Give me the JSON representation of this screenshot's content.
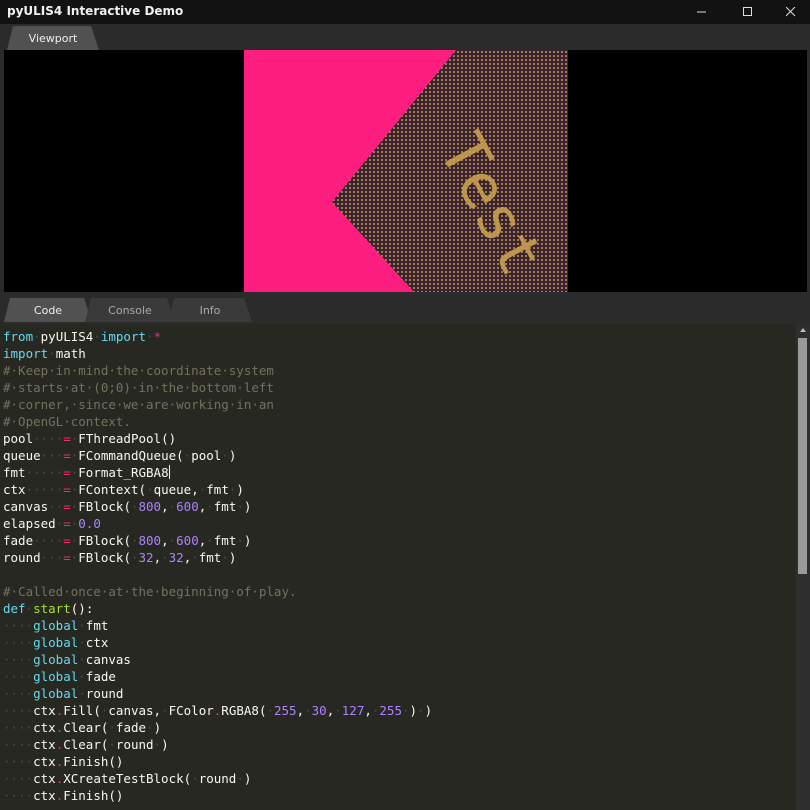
{
  "window": {
    "title": "pyULIS4 Interactive Demo"
  },
  "top_panel": {
    "tabs": [
      {
        "label": "Viewport",
        "active": true
      }
    ],
    "canvas": {
      "background_color": "#fe1e7f",
      "block_color": "#3a2030",
      "text_color": "#c8a050",
      "text": "Test"
    }
  },
  "bottom_panel": {
    "tabs": [
      {
        "label": "Code",
        "active": true
      },
      {
        "label": "Console",
        "active": false
      },
      {
        "label": "Info",
        "active": false
      }
    ],
    "code_lines": [
      "from pyULIS4 import *",
      "import math",
      "# Keep in mind the coordinate system",
      "# starts at (0;0) in the bottom left",
      "# corner, since we are working in an",
      "# OpenGL context.",
      "pool    = FThreadPool()",
      "queue   = FCommandQueue( pool )",
      "fmt     = Format_RGBA8",
      "ctx     = FContext( queue, fmt )",
      "canvas  = FBlock( 800, 600, fmt )",
      "elapsed = 0.0",
      "fade    = FBlock( 800, 600, fmt )",
      "round   = FBlock( 32, 32, fmt )",
      "",
      "# Called once at the beginning of play.",
      "def start():",
      "    global fmt",
      "    global ctx",
      "    global canvas",
      "    global fade",
      "    global round",
      "    ctx.Fill( canvas, FColor.RGBA8( 255, 30, 127, 255 ) )",
      "    ctx.Clear( fade )",
      "    ctx.Clear( round )",
      "    ctx.Finish()",
      "    ctx.XCreateTestBlock( round )",
      "    ctx.Finish()"
    ]
  },
  "theme": {
    "keyword": "#66d9ef",
    "comment": "#75715e",
    "operator": "#f92672",
    "number": "#ae81ff",
    "function": "#a6e22e",
    "text": "#f8f8f2",
    "editor_background": "#272822"
  }
}
